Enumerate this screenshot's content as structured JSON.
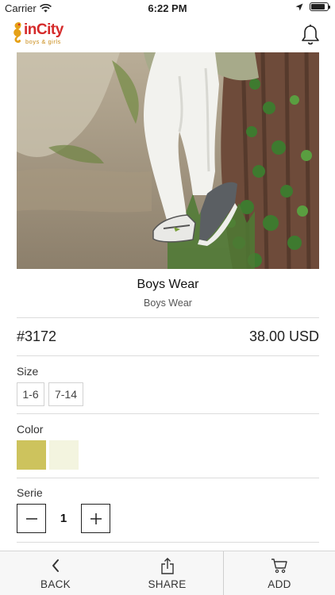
{
  "status_bar": {
    "carrier": "Carrier",
    "time": "6:22 PM"
  },
  "header": {
    "logo_text": "inCity",
    "logo_tagline": "boys & girls"
  },
  "product": {
    "title": "Boys Wear",
    "category": "Boys Wear",
    "code": "#3172",
    "price": "38.00 USD"
  },
  "size": {
    "label": "Size",
    "options": [
      "1-6",
      "7-14"
    ]
  },
  "color": {
    "label": "Color",
    "swatches": [
      "#cdc35d",
      "#f3f4df"
    ]
  },
  "serie": {
    "label": "Serie",
    "quantity": "1"
  },
  "bottom_bar": {
    "back_label": "BACK",
    "share_label": "SHARE",
    "add_label": "ADD"
  }
}
